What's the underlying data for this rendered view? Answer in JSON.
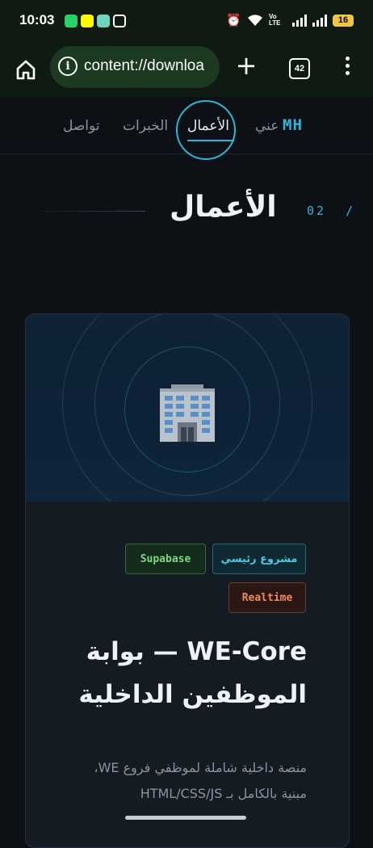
{
  "status_bar": {
    "time": "10:03",
    "network": "Vo LTE",
    "battery": "16"
  },
  "browser": {
    "url": "content://downloa",
    "tab_count": "42"
  },
  "nav": {
    "logo": "MH",
    "items": [
      "عني",
      "الأعمال",
      "الخبرات",
      "تواصل"
    ]
  },
  "section": {
    "number": "02",
    "separator": "/",
    "title": "الأعمال"
  },
  "project": {
    "icon": "office-building-emoji",
    "tags": [
      "مشروع رئيسي",
      "Supabase",
      "Realtime"
    ],
    "title": "WE-Core — بوابة الموظفين الداخلية",
    "description": "منصة داخلية شاملة لموظفي فروع WE، مبنية بالكامل بـ HTML/CSS/JS"
  },
  "colors": {
    "accent": "#2fb6d6",
    "background": "#0d1116",
    "tag_supabase": "#7dd87f",
    "tag_realtime": "#f08a5d"
  }
}
